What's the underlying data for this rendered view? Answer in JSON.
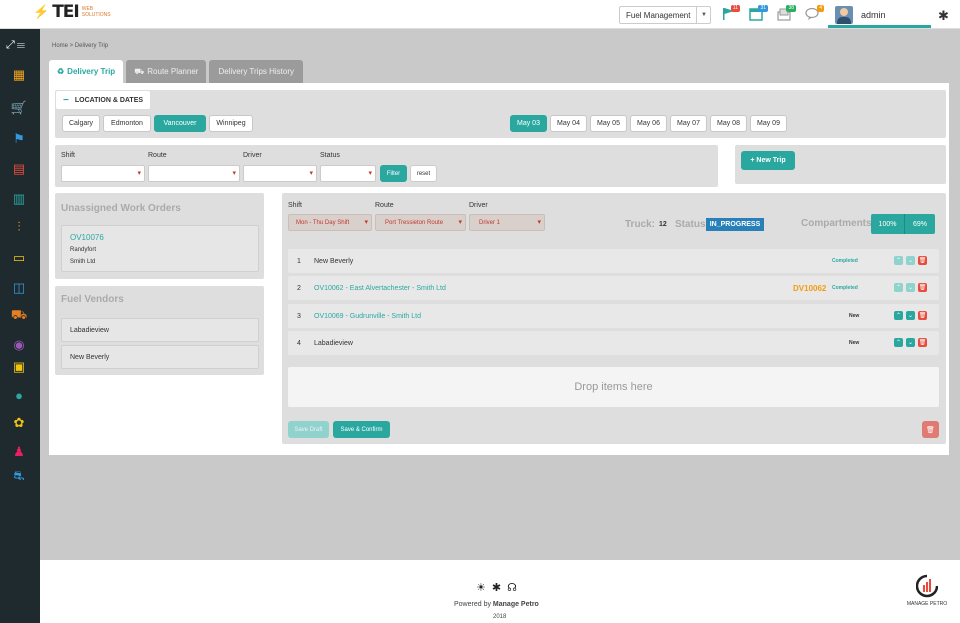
{
  "header": {
    "logo_main": "TEI",
    "logo_sub": "WEB SOLUTIONS",
    "module_select": "Fuel Management",
    "badges": [
      {
        "icon": "flag-icon",
        "count": "11",
        "color": "#e74c3c"
      },
      {
        "icon": "calendar-icon",
        "count": "31",
        "color": "#3498db"
      },
      {
        "icon": "inbox-icon",
        "count": "38",
        "color": "#27ae60"
      },
      {
        "icon": "chat-icon",
        "count": "4",
        "color": "#f39c12"
      }
    ],
    "user_name": "admin"
  },
  "breadcrumb": "Home > Delivery Trip",
  "tabs": [
    {
      "label": "Delivery Trip",
      "icon": "recycle-icon",
      "active": true
    },
    {
      "label": "Route Planner",
      "icon": "truck-icon",
      "active": false
    },
    {
      "label": "Delivery Trips History",
      "icon": "",
      "active": false
    }
  ],
  "location": {
    "header": "LOCATION & DATES",
    "cities": [
      "Calgary",
      "Edmonton",
      "Vancouver",
      "Winnipeg"
    ],
    "selected_city": "Vancouver",
    "dates": [
      "May 03",
      "May 04",
      "May 05",
      "May 06",
      "May 07",
      "May 08",
      "May 09"
    ],
    "selected_date": "May 03"
  },
  "filters": {
    "shift_label": "Shift",
    "route_label": "Route",
    "driver_label": "Driver",
    "status_label": "Status",
    "filter_button": "Filter",
    "reset_button": "reset",
    "new_trip_button": "+ New Trip"
  },
  "unassigned": {
    "title": "Unassigned Work Orders",
    "order_id": "OV10076",
    "line1": "Randyfort",
    "line2": "Smith Ltd"
  },
  "vendors": {
    "title": "Fuel Vendors",
    "items": [
      "Labadieview",
      "New Beverly"
    ]
  },
  "trip": {
    "shift_label": "Shift",
    "route_label": "Route",
    "driver_label": "Driver",
    "shift_value": "Mon - Thu Day Shift",
    "route_value": "Port Tressieton Route",
    "driver_value": "Driver 1",
    "truck_label": "Truck:",
    "truck_value": "12",
    "status_label": "Status:",
    "status_value": "IN_PROGRESS",
    "compartments_label": "Compartments:",
    "compartments": [
      "100%",
      "69%"
    ],
    "rows": [
      {
        "num": "1",
        "name": "New Beverly",
        "link": false,
        "order": "",
        "status": "Completed"
      },
      {
        "num": "2",
        "name": "OV10062 - East Alvertachester - Smith Ltd",
        "link": true,
        "order": "DV10062",
        "status": "Completed"
      },
      {
        "num": "3",
        "name": "OV10069 - Gudrunville - Smith Ltd",
        "link": true,
        "order": "",
        "status": "New"
      },
      {
        "num": "4",
        "name": "Labadieview",
        "link": false,
        "order": "",
        "status": "New"
      }
    ],
    "drop_text": "Drop items here",
    "save_draft": "Save Draft",
    "save_confirm": "Save & Confirm"
  },
  "footer": {
    "powered_by": "Powered by",
    "brand": "Manage Petro",
    "year": "2018",
    "corner_logo_text": "MANAGE PETRO"
  },
  "colors": {
    "accent": "#2aa8a0",
    "sidebar": "#1f2a2f",
    "danger": "#e74c3c",
    "order_orange": "#f39c12",
    "status_blue": "#2980b9"
  }
}
